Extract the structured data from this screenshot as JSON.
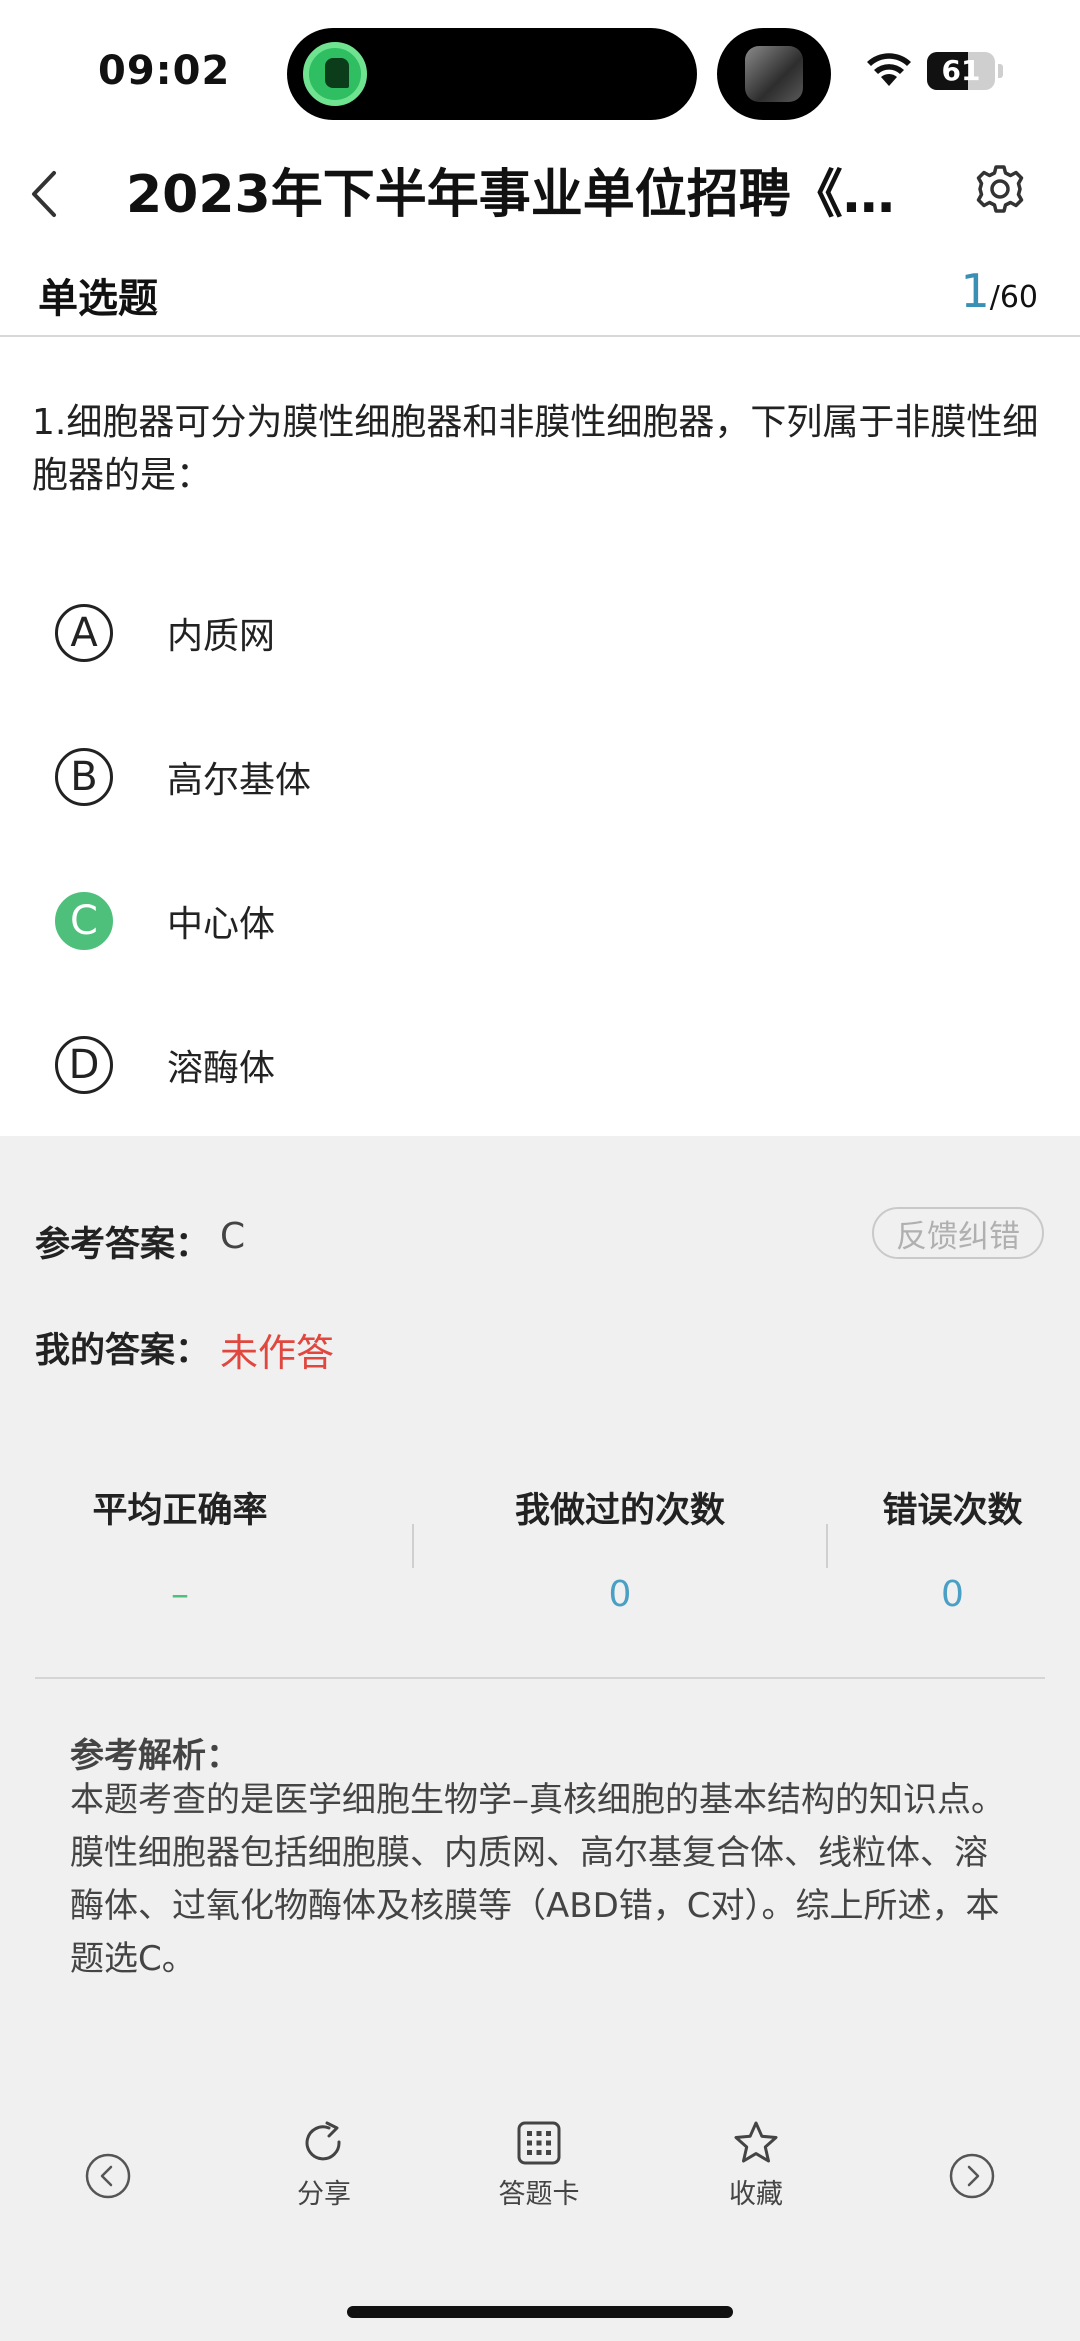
{
  "status_bar": {
    "time": "09:02",
    "battery": "61",
    "battery_level": 0.61
  },
  "nav": {
    "title": "2023年下半年事业单位招聘《综…",
    "back_icon": "chevron-left-icon",
    "settings_icon": "gear-icon"
  },
  "question_header": {
    "type": "单选题",
    "current": "1",
    "total": "/60"
  },
  "question": {
    "text": "1.细胞器可分为膜性细胞器和非膜性细胞器，下列属于非膜性细胞器的是："
  },
  "options": [
    {
      "letter": "A",
      "text": "内质网",
      "correct": false
    },
    {
      "letter": "B",
      "text": "高尔基体",
      "correct": false
    },
    {
      "letter": "C",
      "text": "中心体",
      "correct": true
    },
    {
      "letter": "D",
      "text": "溶酶体",
      "correct": false
    }
  ],
  "answer": {
    "ref_label": "参考答案：",
    "ref_value": "C",
    "feedback": "反馈纠错",
    "my_label": "我的答案：",
    "my_value": "未作答"
  },
  "stats": {
    "avg_label": "平均正确率",
    "avg_value": "–",
    "done_label": "我做过的次数",
    "done_value": "0",
    "wrong_label": "错误次数",
    "wrong_value": "0"
  },
  "analysis": {
    "label": "参考解析：",
    "text": "本题考查的是医学细胞生物学–真核细胞的基本结构的知识点。膜性细胞器包括细胞膜、内质网、高尔基复合体、线粒体、溶酶体、过氧化物酶体及核膜等（ABD错，C对）。综上所述，本题选C。"
  },
  "toolbar": {
    "share": "分享",
    "answer_card": "答题卡",
    "favorite": "收藏"
  },
  "colors": {
    "accent_blue": "#3a8fb5",
    "correct_green": "#4ec07c",
    "error_red": "#e0473f"
  }
}
